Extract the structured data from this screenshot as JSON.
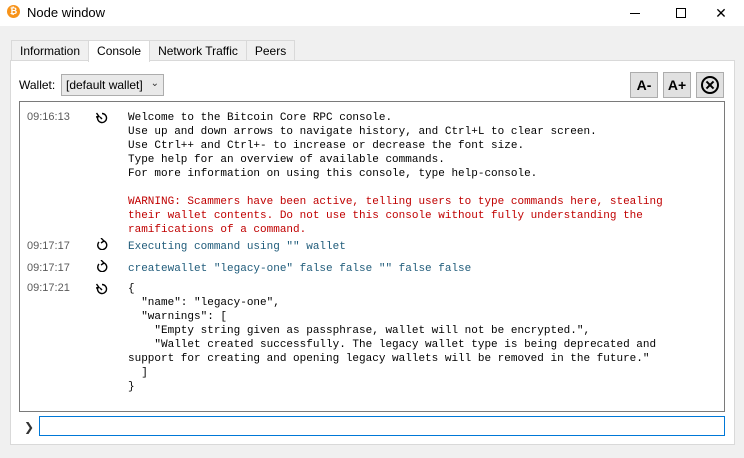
{
  "window": {
    "title": "Node window",
    "app_icon_glyph": "₿",
    "app_icon_name": "bitcoin-logo-icon",
    "min_glyph": "",
    "close_glyph": "✕"
  },
  "tabs": [
    {
      "label": "Information",
      "active": false
    },
    {
      "label": "Console",
      "active": true
    },
    {
      "label": "Network Traffic",
      "active": false
    },
    {
      "label": "Peers",
      "active": false
    }
  ],
  "wallet": {
    "label": "Wallet:",
    "selected": "[default wallet]",
    "chevron": "⌄"
  },
  "toolbar": {
    "font_smaller": "A-",
    "font_bigger": "A+",
    "clear_icon": "clear-console-icon"
  },
  "console": {
    "entries": [
      {
        "time": "09:16:13",
        "icon": "reply-icon",
        "kind": "reply",
        "lines": [
          "Welcome to the Bitcoin Core RPC console.",
          "Use up and down arrows to navigate history, and Ctrl+L to clear screen.",
          "Use Ctrl++ and Ctrl+- to increase or decrease the font size.",
          "Type help for an overview of available commands.",
          "For more information on using this console, type help-console."
        ],
        "warning_lines": [
          "WARNING: Scammers have been active, telling users to type commands here, stealing",
          "their wallet contents. Do not use this console without fully understanding the",
          "ramifications of a command."
        ]
      },
      {
        "time": "09:17:17",
        "icon": "request-icon",
        "kind": "request",
        "text": "Executing command using \"\" wallet"
      },
      {
        "time": "09:17:17",
        "icon": "request-icon",
        "kind": "request",
        "text": "createwallet \"legacy-one\" false false \"\" false false"
      },
      {
        "time": "09:17:21",
        "icon": "reply-icon",
        "kind": "reply",
        "lines": [
          "{",
          "  \"name\": \"legacy-one\",",
          "  \"warnings\": [",
          "    \"Empty string given as passphrase, wallet will not be encrypted.\",",
          "    \"Wallet created successfully. The legacy wallet type is being deprecated and",
          "support for creating and opening legacy wallets will be removed in the future.\"",
          "  ]",
          "}"
        ]
      }
    ]
  },
  "input": {
    "value": "",
    "placeholder": "",
    "prompt_glyph": "❯"
  },
  "colors": {
    "keyword": "#1f5b7a",
    "warning": "#c00000",
    "input_focus": "#0078d7",
    "bitcoin_orange": "#f7931a"
  }
}
